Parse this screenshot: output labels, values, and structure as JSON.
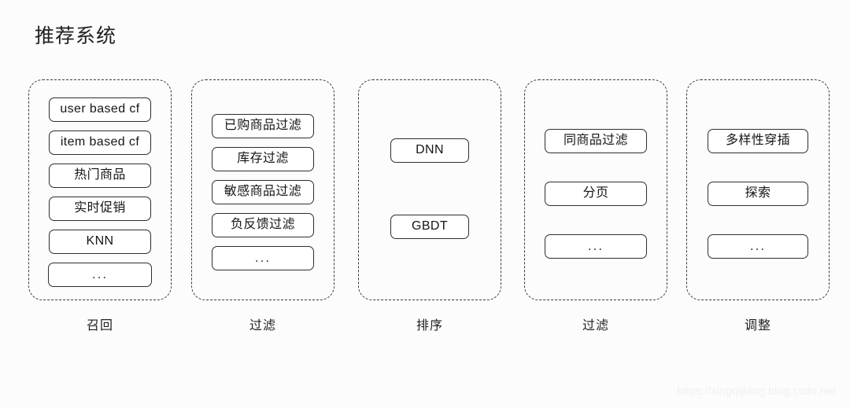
{
  "page": {
    "title": "推荐系统",
    "background_color": "#fcfcfc",
    "node_border_color": "#2e2e2e",
    "stage_border_color": "#3a3a3a",
    "watermark": "https://xingqijiang.blog.csdn.net"
  },
  "stages": [
    {
      "label": "召回",
      "nodes": [
        {
          "text": "user based cf"
        },
        {
          "text": "item based cf"
        },
        {
          "text": "热门商品"
        },
        {
          "text": "实时促销"
        },
        {
          "text": "KNN"
        },
        {
          "text": "..."
        }
      ]
    },
    {
      "label": "过滤",
      "nodes": [
        {
          "text": "已购商品过滤"
        },
        {
          "text": "库存过滤"
        },
        {
          "text": "敏感商品过滤"
        },
        {
          "text": "负反馈过滤"
        },
        {
          "text": "..."
        }
      ]
    },
    {
      "label": "排序",
      "nodes": [
        {
          "text": "DNN"
        },
        {
          "text": "GBDT"
        }
      ]
    },
    {
      "label": "过滤",
      "nodes": [
        {
          "text": "同商品过滤"
        },
        {
          "text": "分页"
        },
        {
          "text": "..."
        }
      ]
    },
    {
      "label": "调整",
      "nodes": [
        {
          "text": "多样性穿插"
        },
        {
          "text": "探索"
        },
        {
          "text": "..."
        }
      ]
    }
  ]
}
